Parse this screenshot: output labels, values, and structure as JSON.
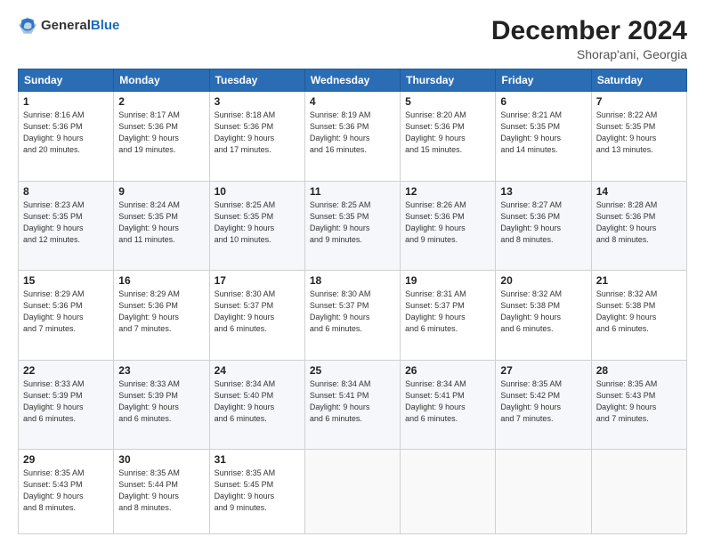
{
  "header": {
    "logo_general": "General",
    "logo_blue": "Blue",
    "month_title": "December 2024",
    "location": "Shorap'ani, Georgia"
  },
  "days_of_week": [
    "Sunday",
    "Monday",
    "Tuesday",
    "Wednesday",
    "Thursday",
    "Friday",
    "Saturday"
  ],
  "weeks": [
    [
      {
        "day": "1",
        "sunrise": "8:16 AM",
        "sunset": "5:36 PM",
        "daylight_h": "9",
        "daylight_m": "20"
      },
      {
        "day": "2",
        "sunrise": "8:17 AM",
        "sunset": "5:36 PM",
        "daylight_h": "9",
        "daylight_m": "19"
      },
      {
        "day": "3",
        "sunrise": "8:18 AM",
        "sunset": "5:36 PM",
        "daylight_h": "9",
        "daylight_m": "17"
      },
      {
        "day": "4",
        "sunrise": "8:19 AM",
        "sunset": "5:36 PM",
        "daylight_h": "9",
        "daylight_m": "16"
      },
      {
        "day": "5",
        "sunrise": "8:20 AM",
        "sunset": "5:36 PM",
        "daylight_h": "9",
        "daylight_m": "15"
      },
      {
        "day": "6",
        "sunrise": "8:21 AM",
        "sunset": "5:35 PM",
        "daylight_h": "9",
        "daylight_m": "14"
      },
      {
        "day": "7",
        "sunrise": "8:22 AM",
        "sunset": "5:35 PM",
        "daylight_h": "9",
        "daylight_m": "13"
      }
    ],
    [
      {
        "day": "8",
        "sunrise": "8:23 AM",
        "sunset": "5:35 PM",
        "daylight_h": "9",
        "daylight_m": "12"
      },
      {
        "day": "9",
        "sunrise": "8:24 AM",
        "sunset": "5:35 PM",
        "daylight_h": "9",
        "daylight_m": "11"
      },
      {
        "day": "10",
        "sunrise": "8:25 AM",
        "sunset": "5:35 PM",
        "daylight_h": "9",
        "daylight_m": "10"
      },
      {
        "day": "11",
        "sunrise": "8:25 AM",
        "sunset": "5:35 PM",
        "daylight_h": "9",
        "daylight_m": "9"
      },
      {
        "day": "12",
        "sunrise": "8:26 AM",
        "sunset": "5:36 PM",
        "daylight_h": "9",
        "daylight_m": "9"
      },
      {
        "day": "13",
        "sunrise": "8:27 AM",
        "sunset": "5:36 PM",
        "daylight_h": "9",
        "daylight_m": "8"
      },
      {
        "day": "14",
        "sunrise": "8:28 AM",
        "sunset": "5:36 PM",
        "daylight_h": "9",
        "daylight_m": "8"
      }
    ],
    [
      {
        "day": "15",
        "sunrise": "8:29 AM",
        "sunset": "5:36 PM",
        "daylight_h": "9",
        "daylight_m": "7"
      },
      {
        "day": "16",
        "sunrise": "8:29 AM",
        "sunset": "5:36 PM",
        "daylight_h": "9",
        "daylight_m": "7"
      },
      {
        "day": "17",
        "sunrise": "8:30 AM",
        "sunset": "5:37 PM",
        "daylight_h": "9",
        "daylight_m": "6"
      },
      {
        "day": "18",
        "sunrise": "8:30 AM",
        "sunset": "5:37 PM",
        "daylight_h": "9",
        "daylight_m": "6"
      },
      {
        "day": "19",
        "sunrise": "8:31 AM",
        "sunset": "5:37 PM",
        "daylight_h": "9",
        "daylight_m": "6"
      },
      {
        "day": "20",
        "sunrise": "8:32 AM",
        "sunset": "5:38 PM",
        "daylight_h": "9",
        "daylight_m": "6"
      },
      {
        "day": "21",
        "sunrise": "8:32 AM",
        "sunset": "5:38 PM",
        "daylight_h": "9",
        "daylight_m": "6"
      }
    ],
    [
      {
        "day": "22",
        "sunrise": "8:33 AM",
        "sunset": "5:39 PM",
        "daylight_h": "9",
        "daylight_m": "6"
      },
      {
        "day": "23",
        "sunrise": "8:33 AM",
        "sunset": "5:39 PM",
        "daylight_h": "9",
        "daylight_m": "6"
      },
      {
        "day": "24",
        "sunrise": "8:34 AM",
        "sunset": "5:40 PM",
        "daylight_h": "9",
        "daylight_m": "6"
      },
      {
        "day": "25",
        "sunrise": "8:34 AM",
        "sunset": "5:41 PM",
        "daylight_h": "9",
        "daylight_m": "6"
      },
      {
        "day": "26",
        "sunrise": "8:34 AM",
        "sunset": "5:41 PM",
        "daylight_h": "9",
        "daylight_m": "6"
      },
      {
        "day": "27",
        "sunrise": "8:35 AM",
        "sunset": "5:42 PM",
        "daylight_h": "9",
        "daylight_m": "7"
      },
      {
        "day": "28",
        "sunrise": "8:35 AM",
        "sunset": "5:43 PM",
        "daylight_h": "9",
        "daylight_m": "7"
      }
    ],
    [
      {
        "day": "29",
        "sunrise": "8:35 AM",
        "sunset": "5:43 PM",
        "daylight_h": "9",
        "daylight_m": "8"
      },
      {
        "day": "30",
        "sunrise": "8:35 AM",
        "sunset": "5:44 PM",
        "daylight_h": "9",
        "daylight_m": "8"
      },
      {
        "day": "31",
        "sunrise": "8:35 AM",
        "sunset": "5:45 PM",
        "daylight_h": "9",
        "daylight_m": "9"
      },
      null,
      null,
      null,
      null
    ]
  ],
  "labels": {
    "sunrise": "Sunrise:",
    "sunset": "Sunset:",
    "daylight": "Daylight:",
    "hours": "hours",
    "and": "and",
    "minutes": "minutes."
  }
}
